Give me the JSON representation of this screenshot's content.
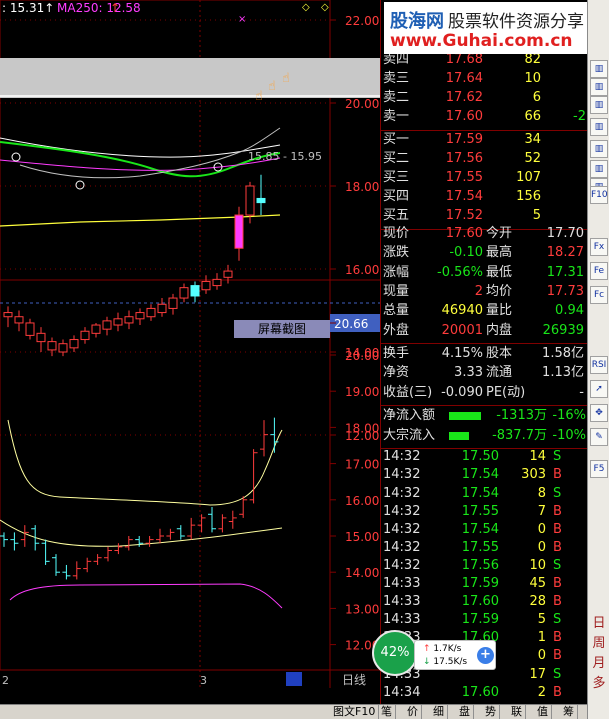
{
  "chart_header": {
    "ma_prev": "15.31",
    "ma250_label": "MA250: 12.58"
  },
  "main_price_axis": [
    "22.00",
    "20.00",
    "18.00",
    "16.00",
    "14.00",
    "12.00"
  ],
  "sub_price_axis": [
    "20.66",
    "20.00",
    "19.00",
    "18.00",
    "17.00",
    "16.00",
    "15.00",
    "14.00",
    "13.00",
    "12.00"
  ],
  "annotation": "15.85 - 15.95",
  "date_labels": [
    "2",
    "3"
  ],
  "period_label": "日线",
  "screenshot_tip": "屏幕截图",
  "colors": {
    "up": "#ff3c3c",
    "down": "#55ffff",
    "ma_white": "#ffffff",
    "ma_yellow": "#ffff3c",
    "ma_green": "#19e619",
    "ma_magenta": "#ff3cff",
    "grid": "#800000"
  },
  "watermark": {
    "brand": "股海网",
    "tagline": "股票软件资源分享",
    "url": "www.Guhai.com.cn"
  },
  "order_book": {
    "asks": [
      {
        "label": "卖四",
        "price": "17.68",
        "vol": "82"
      },
      {
        "label": "卖三",
        "price": "17.64",
        "vol": "10"
      },
      {
        "label": "卖二",
        "price": "17.62",
        "vol": "6"
      },
      {
        "label": "卖一",
        "price": "17.60",
        "vol": "66",
        "chg": "-2"
      }
    ],
    "bids": [
      {
        "label": "买一",
        "price": "17.59",
        "vol": "34"
      },
      {
        "label": "买二",
        "price": "17.56",
        "vol": "52"
      },
      {
        "label": "买三",
        "price": "17.55",
        "vol": "107"
      },
      {
        "label": "买四",
        "price": "17.54",
        "vol": "156"
      },
      {
        "label": "买五",
        "price": "17.52",
        "vol": "5"
      }
    ]
  },
  "stats": [
    {
      "l1": "现价",
      "v1": "17.60",
      "c1": "red",
      "l2": "今开",
      "v2": "17.70",
      "c2": "white"
    },
    {
      "l1": "涨跌",
      "v1": "-0.10",
      "c1": "green",
      "l2": "最高",
      "v2": "18.27",
      "c2": "red"
    },
    {
      "l1": "涨幅",
      "v1": "-0.56%",
      "c1": "green",
      "l2": "最低",
      "v2": "17.31",
      "c2": "green"
    },
    {
      "l1": "现量",
      "v1": "2",
      "c1": "red",
      "l2": "均价",
      "v2": "17.73",
      "c2": "red"
    },
    {
      "l1": "总量",
      "v1": "46940",
      "c1": "yellow",
      "l2": "量比",
      "v2": "0.94",
      "c2": "green"
    },
    {
      "l1": "外盘",
      "v1": "20001",
      "c1": "red",
      "l2": "内盘",
      "v2": "26939",
      "c2": "green"
    }
  ],
  "fundamentals": [
    {
      "l1": "换手",
      "v1": "4.15%",
      "l2": "股本",
      "v2": "1.58亿"
    },
    {
      "l1": "净资",
      "v1": "3.33",
      "l2": "流通",
      "v2": "1.13亿"
    },
    {
      "l1": "收益(三)",
      "v1": "-0.090",
      "l2": "PE(动)",
      "v2": "-"
    }
  ],
  "flows": [
    {
      "label": "净流入额",
      "value": "-1313万",
      "pct": "-16%",
      "bar": 0.16
    },
    {
      "label": "大宗流入",
      "value": "-837.7万",
      "pct": "-10%",
      "bar": 0.1
    }
  ],
  "ticks": [
    {
      "time": "14:32",
      "price": "17.50",
      "vol": "14",
      "side": "S"
    },
    {
      "time": "14:32",
      "price": "17.54",
      "vol": "303",
      "side": "B"
    },
    {
      "time": "14:32",
      "price": "17.54",
      "vol": "8",
      "side": "S"
    },
    {
      "time": "14:32",
      "price": "17.55",
      "vol": "7",
      "side": "B"
    },
    {
      "time": "14:32",
      "price": "17.54",
      "vol": "0",
      "side": "B"
    },
    {
      "time": "14:32",
      "price": "17.55",
      "vol": "0",
      "side": "B"
    },
    {
      "time": "14:32",
      "price": "17.56",
      "vol": "10",
      "side": "S"
    },
    {
      "time": "14:33",
      "price": "17.59",
      "vol": "45",
      "side": "B"
    },
    {
      "time": "14:33",
      "price": "17.60",
      "vol": "28",
      "side": "B"
    },
    {
      "time": "14:33",
      "price": "17.59",
      "vol": "5",
      "side": "S"
    },
    {
      "time": "14:33",
      "price": "17.60",
      "vol": "1",
      "side": "B"
    },
    {
      "time": "14:33",
      "price": "",
      "vol": "0",
      "side": "B"
    },
    {
      "time": "14:33",
      "price": "",
      "vol": "17",
      "side": "S"
    },
    {
      "time": "14:34",
      "price": "17.60",
      "vol": "2",
      "side": "B"
    }
  ],
  "net_widget": {
    "percent": "42%",
    "up": "1.7K/s",
    "down": "17.5K/s"
  },
  "status_tabs": [
    "图文F10",
    "笔",
    "价",
    "细",
    "盘",
    "势",
    "联",
    "值",
    "筹"
  ],
  "toolbar": {
    "buttons": [
      "F10",
      "Fx",
      "Fe",
      "Fc",
      "F5",
      "RSI"
    ],
    "chars": [
      "日",
      "周",
      "月",
      "多"
    ]
  }
}
